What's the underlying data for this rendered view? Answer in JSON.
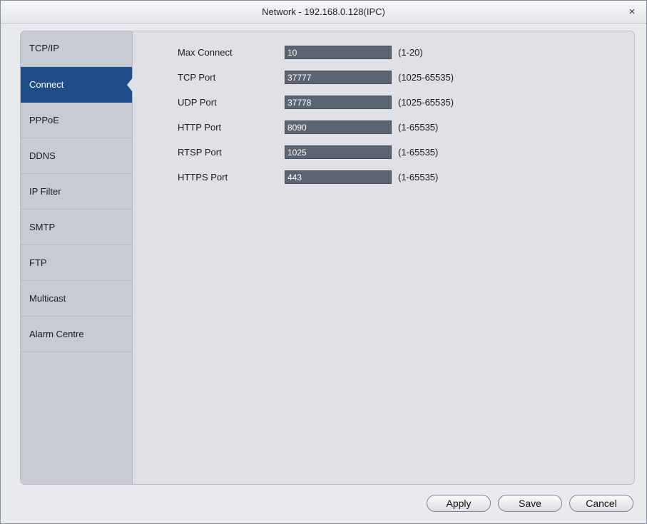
{
  "window": {
    "title": "Network - 192.168.0.128(IPC)",
    "close_glyph": "×"
  },
  "sidebar": {
    "items": [
      {
        "label": "TCP/IP",
        "active": false
      },
      {
        "label": "Connect",
        "active": true
      },
      {
        "label": "PPPoE",
        "active": false
      },
      {
        "label": "DDNS",
        "active": false
      },
      {
        "label": "IP Filter",
        "active": false
      },
      {
        "label": "SMTP",
        "active": false
      },
      {
        "label": "FTP",
        "active": false
      },
      {
        "label": "Multicast",
        "active": false
      },
      {
        "label": "Alarm Centre",
        "active": false
      }
    ]
  },
  "connect_form": {
    "rows": [
      {
        "label": "Max Connect",
        "value": "10",
        "range": "(1-20)"
      },
      {
        "label": "TCP Port",
        "value": "37777",
        "range": "(1025-65535)"
      },
      {
        "label": "UDP Port",
        "value": "37778",
        "range": "(1025-65535)"
      },
      {
        "label": "HTTP Port",
        "value": "8090",
        "range": "(1-65535)"
      },
      {
        "label": "RTSP Port",
        "value": "1025",
        "range": "(1-65535)"
      },
      {
        "label": "HTTPS Port",
        "value": "443",
        "range": "(1-65535)"
      }
    ]
  },
  "footer": {
    "apply_label": "Apply",
    "save_label": "Save",
    "cancel_label": "Cancel"
  },
  "colors": {
    "active_nav": "#1f4d8a",
    "input_bg": "#5d6471",
    "sidebar_bg": "#c7cbd3",
    "panel_bg": "#dfe1e6"
  }
}
